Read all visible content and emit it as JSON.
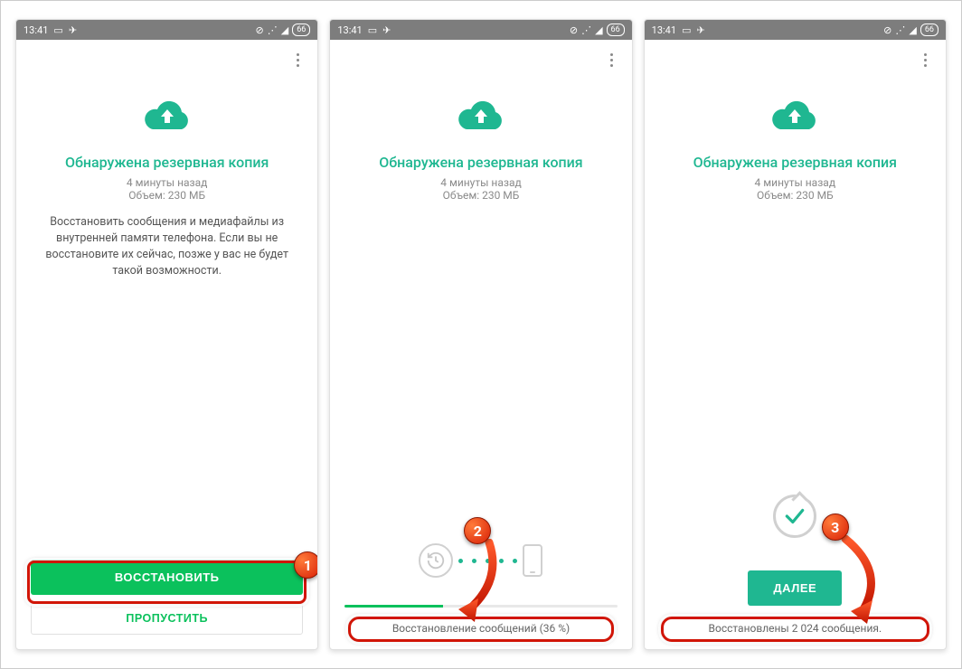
{
  "status_bar": {
    "time": "13:41",
    "battery_percent": "66"
  },
  "common": {
    "title": "Обнаружена резервная копия",
    "backup_age": "4 минуты назад",
    "backup_size": "Объем: 230 МБ"
  },
  "screen1": {
    "description": "Восстановить сообщения и медиафайлы из внутренней памяти телефона. Если вы не восстановите их сейчас, позже у вас не будет такой возможности.",
    "restore_label": "ВОССТАНОВИТЬ",
    "skip_label": "ПРОПУСТИТЬ"
  },
  "screen2": {
    "progress_percent": 36,
    "progress_text": "Восстановление сообщений (36 %)"
  },
  "screen3": {
    "next_label": "ДАЛЕЕ",
    "result_text": "Восстановлены 2 024 сообщения."
  },
  "annotations": {
    "badge1": "1",
    "badge2": "2",
    "badge3": "3"
  },
  "colors": {
    "accent_teal": "#1fb791",
    "accent_green": "#0bc15c",
    "annotation_red": "#d11507"
  }
}
